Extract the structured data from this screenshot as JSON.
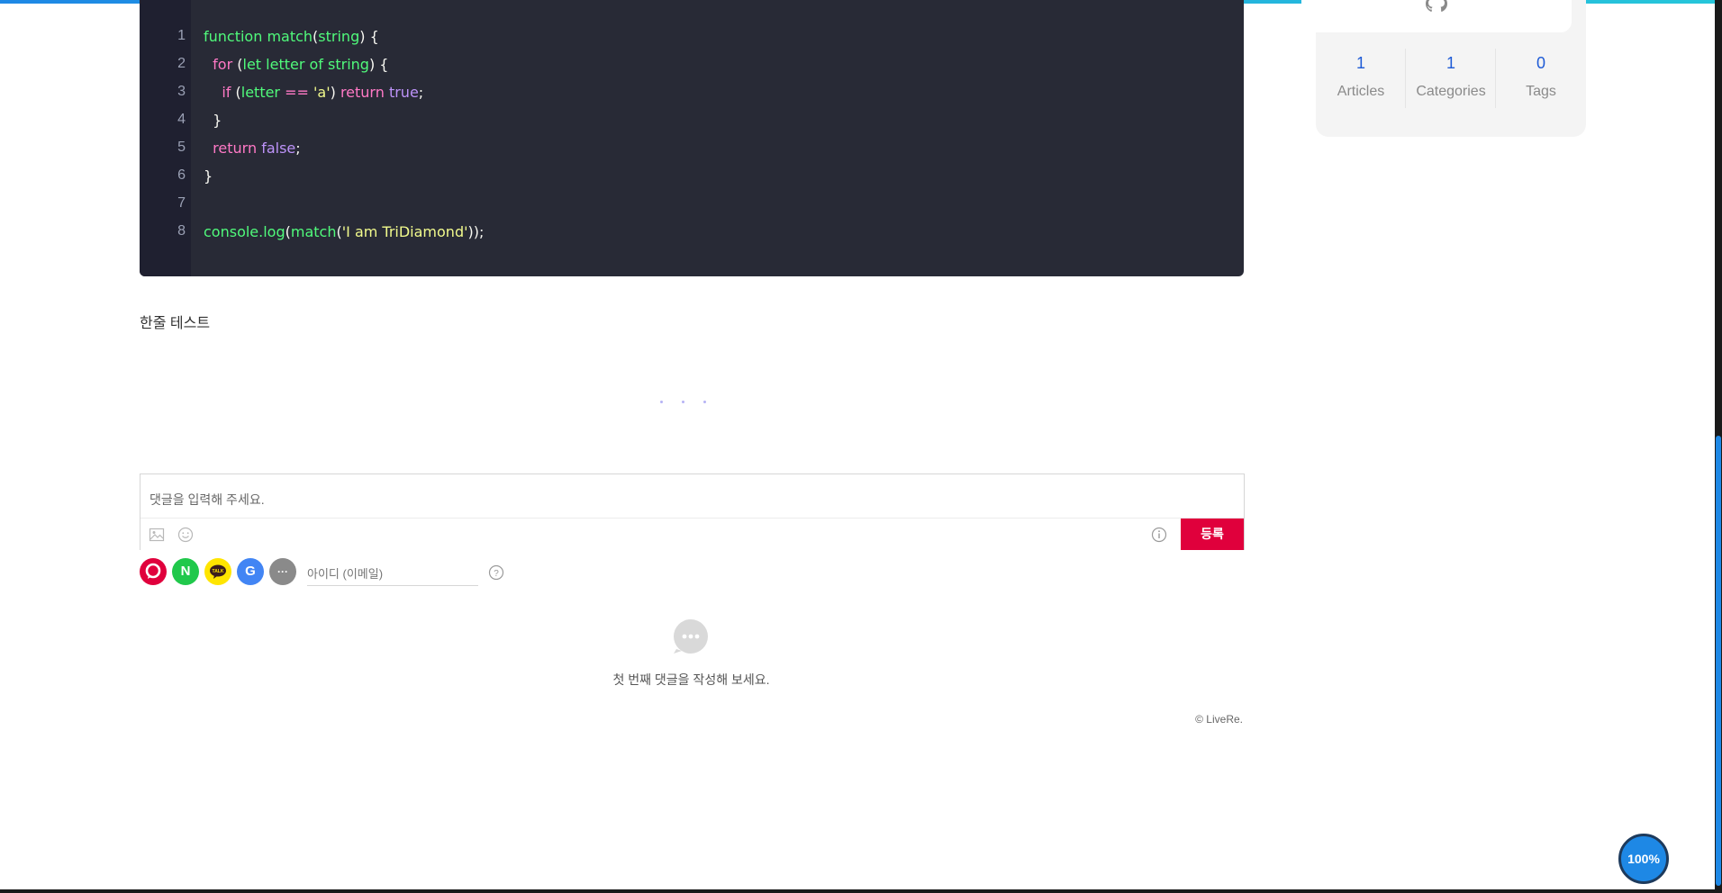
{
  "code": {
    "line_numbers": [
      "1",
      "2",
      "3",
      "4",
      "5",
      "6",
      "7",
      "8"
    ],
    "lines": [
      [
        {
          "t": "fn",
          "v": "function match"
        },
        {
          "t": "plain",
          "v": "("
        },
        {
          "t": "fn",
          "v": "string"
        },
        {
          "t": "plain",
          "v": ") {"
        }
      ],
      [
        {
          "t": "plain",
          "v": "  "
        },
        {
          "t": "kw",
          "v": "for"
        },
        {
          "t": "plain",
          "v": " ("
        },
        {
          "t": "fn",
          "v": "let letter of string"
        },
        {
          "t": "plain",
          "v": ") {"
        }
      ],
      [
        {
          "t": "plain",
          "v": "    "
        },
        {
          "t": "kw",
          "v": "if"
        },
        {
          "t": "plain",
          "v": " ("
        },
        {
          "t": "fn",
          "v": "letter "
        },
        {
          "t": "op",
          "v": "=="
        },
        {
          "t": "plain",
          "v": " "
        },
        {
          "t": "str",
          "v": "'a'"
        },
        {
          "t": "plain",
          "v": ") "
        },
        {
          "t": "kw",
          "v": "return"
        },
        {
          "t": "plain",
          "v": " "
        },
        {
          "t": "bool",
          "v": "true"
        },
        {
          "t": "plain",
          "v": ";"
        }
      ],
      [
        {
          "t": "plain",
          "v": "  }"
        }
      ],
      [
        {
          "t": "plain",
          "v": "  "
        },
        {
          "t": "kw",
          "v": "return"
        },
        {
          "t": "plain",
          "v": " "
        },
        {
          "t": "bool",
          "v": "false"
        },
        {
          "t": "plain",
          "v": ";"
        }
      ],
      [
        {
          "t": "plain",
          "v": "}"
        }
      ],
      [],
      [
        {
          "t": "fn",
          "v": "console.log"
        },
        {
          "t": "plain",
          "v": "("
        },
        {
          "t": "fn",
          "v": "match"
        },
        {
          "t": "plain",
          "v": "("
        },
        {
          "t": "str",
          "v": "'I am TriDiamond'"
        },
        {
          "t": "plain",
          "v": "));"
        }
      ]
    ]
  },
  "content": {
    "section_text": "한줄 테스트"
  },
  "comments": {
    "input_placeholder": "댓글을 입력해 주세요.",
    "submit_label": "등록",
    "id_placeholder": "아이디 (이메일)",
    "help_label": "?",
    "empty_message": "첫 번째 댓글을 작성해 보세요.",
    "copyright": "© LiveRe.",
    "sns": [
      {
        "name": "livere",
        "label": "",
        "color": "#e0003c"
      },
      {
        "name": "naver",
        "label": "N",
        "color": "#20c84b"
      },
      {
        "name": "kakao",
        "label": "TALK",
        "color": "#ffe500"
      },
      {
        "name": "google",
        "label": "G",
        "color": "#4285f4"
      },
      {
        "name": "more",
        "label": "···",
        "color": "#8a8a8a"
      }
    ]
  },
  "sidebar": {
    "stats": [
      {
        "count": "1",
        "label": "Articles"
      },
      {
        "count": "1",
        "label": "Categories"
      },
      {
        "count": "0",
        "label": "Tags"
      }
    ]
  },
  "progress": {
    "label": "100%",
    "value_percent": 100
  },
  "colors": {
    "accent": "#1e88e5",
    "submit": "#e0003c",
    "stat_number": "#1e5bd6"
  }
}
